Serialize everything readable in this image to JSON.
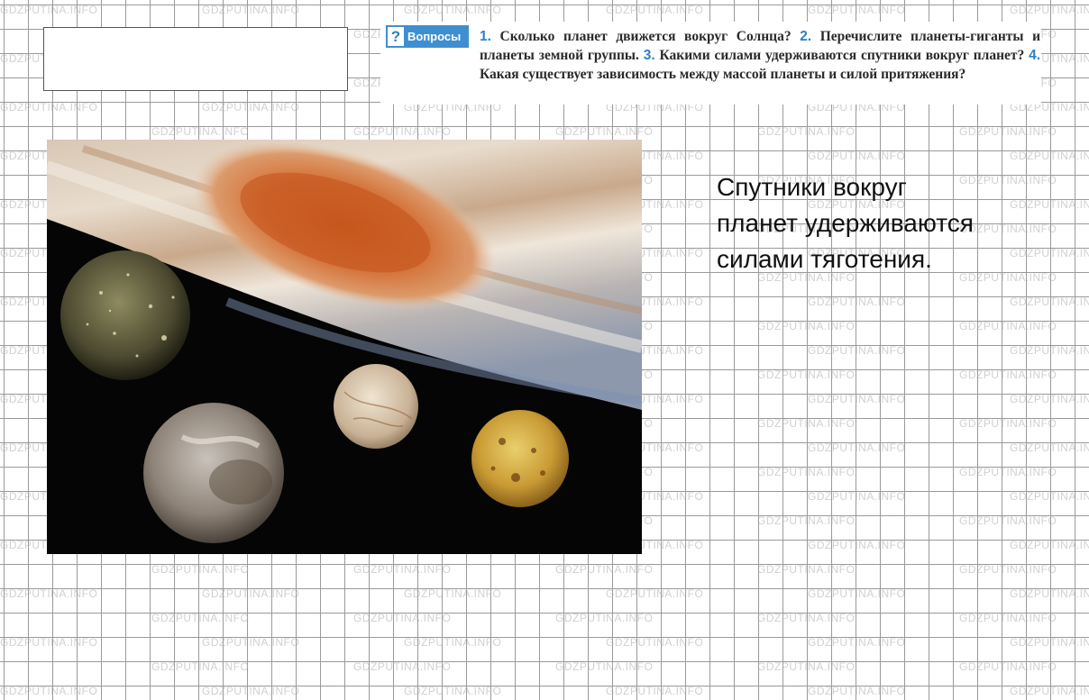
{
  "watermark": "GDZPUTINA.INFO",
  "questions": {
    "badge_label": "Вопросы",
    "items": [
      {
        "num": "1.",
        "text": "Сколько планет движется вокруг Солнца?"
      },
      {
        "num": "2.",
        "text": "Перечислите планеты-гиганты и планеты земной группы."
      },
      {
        "num": "3.",
        "text": "Какими силами удерживаются спутники вокруг планет?"
      },
      {
        "num": "4.",
        "text": "Какая существует зависимость между массой планеты и силой притяжения?"
      }
    ]
  },
  "answer": {
    "lines": [
      "Спутники вокруг",
      "планет удерживаются",
      "силами тяготения."
    ]
  },
  "colors": {
    "accent": "#3f8fd0",
    "grid": "#9a9a9a"
  }
}
